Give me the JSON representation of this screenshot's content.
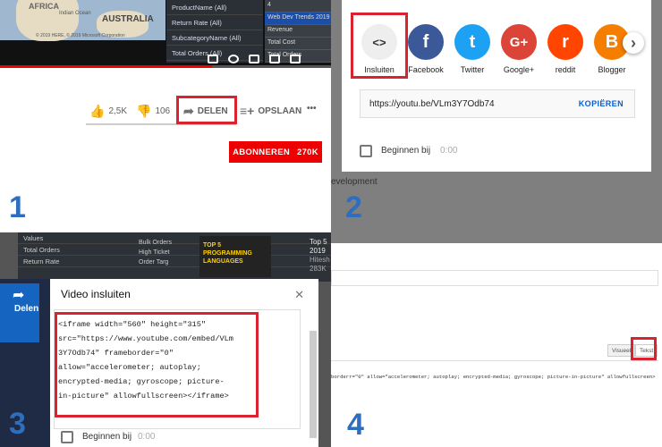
{
  "steps": [
    "1",
    "2",
    "3",
    "4"
  ],
  "q1": {
    "map_labels": [
      "AFRICA",
      "Indian Ocean",
      "AUSTRALIA"
    ],
    "map_credit": "© 2019 HERE, © 2019 Microsoft Corporation",
    "filters": [
      "ProductName (All)",
      "Return Rate (All)",
      "SubcategoryName (All)",
      "Total Orders (All)"
    ],
    "right_list": [
      "4",
      "Web Dev Trends 2019",
      "Revenue",
      "Total Cost",
      "Total Orders"
    ],
    "likes": "2,5K",
    "dislikes": "106",
    "share": "DELEN",
    "save": "OPSLAAN",
    "more": "•••",
    "subscribe": "ABONNEREN",
    "subs": "270K"
  },
  "q2": {
    "share_items": [
      {
        "label": "Insluiten",
        "glyph": "<>",
        "color": "#eeeeee"
      },
      {
        "label": "Facebook",
        "glyph": "f",
        "color": "#3b5998"
      },
      {
        "label": "Twitter",
        "glyph": "t",
        "color": "#1da1f2"
      },
      {
        "label": "Google+",
        "glyph": "G+",
        "color": "#db4437"
      },
      {
        "label": "reddit",
        "glyph": "r",
        "color": "#ff4500"
      },
      {
        "label": "Blogger",
        "glyph": "B",
        "color": "#f57d00"
      }
    ],
    "next": "›",
    "url": "https://youtu.be/VLm3Y7Odb74",
    "copy": "KOPIËREN",
    "start": "Beginnen bij",
    "start_time": "0:00",
    "behind": "evelopment"
  },
  "q3": {
    "bg_rows": [
      "Values",
      "Total Orders",
      "Return Rate",
      "",
      "",
      ""
    ],
    "bg_list": [
      "Bulk Orders",
      "High Ticket",
      "Order Targ"
    ],
    "thumb": "TOP 5 PROGRAMMING LANGUAGES",
    "side_title": "Top 5",
    "side_sub": "2019",
    "side_chan": "Hitesh",
    "side_views": "283K",
    "share": "Delen",
    "title": "Video insluiten",
    "close": "✕",
    "code": "<iframe width=\"560\" height=\"315\"\nsrc=\"https://www.youtube.com/embed/VLm\n3Y7Odb74\" frameborder=\"0\"\nallow=\"accelerometer; autoplay;\nencrypted-media; gyroscope; picture-\nin-picture\" allowfullscreen></iframe>",
    "start": "Beginnen bij",
    "start_time": "0:00"
  },
  "q4": {
    "tab_visual": "Visueel",
    "tab_text": "Tekst",
    "code_line": "borderr=\"0\" allow=\"accelerometer; autoplay; encrypted-media; gyroscope; picture-in-picture\" allowfullscreen>"
  }
}
